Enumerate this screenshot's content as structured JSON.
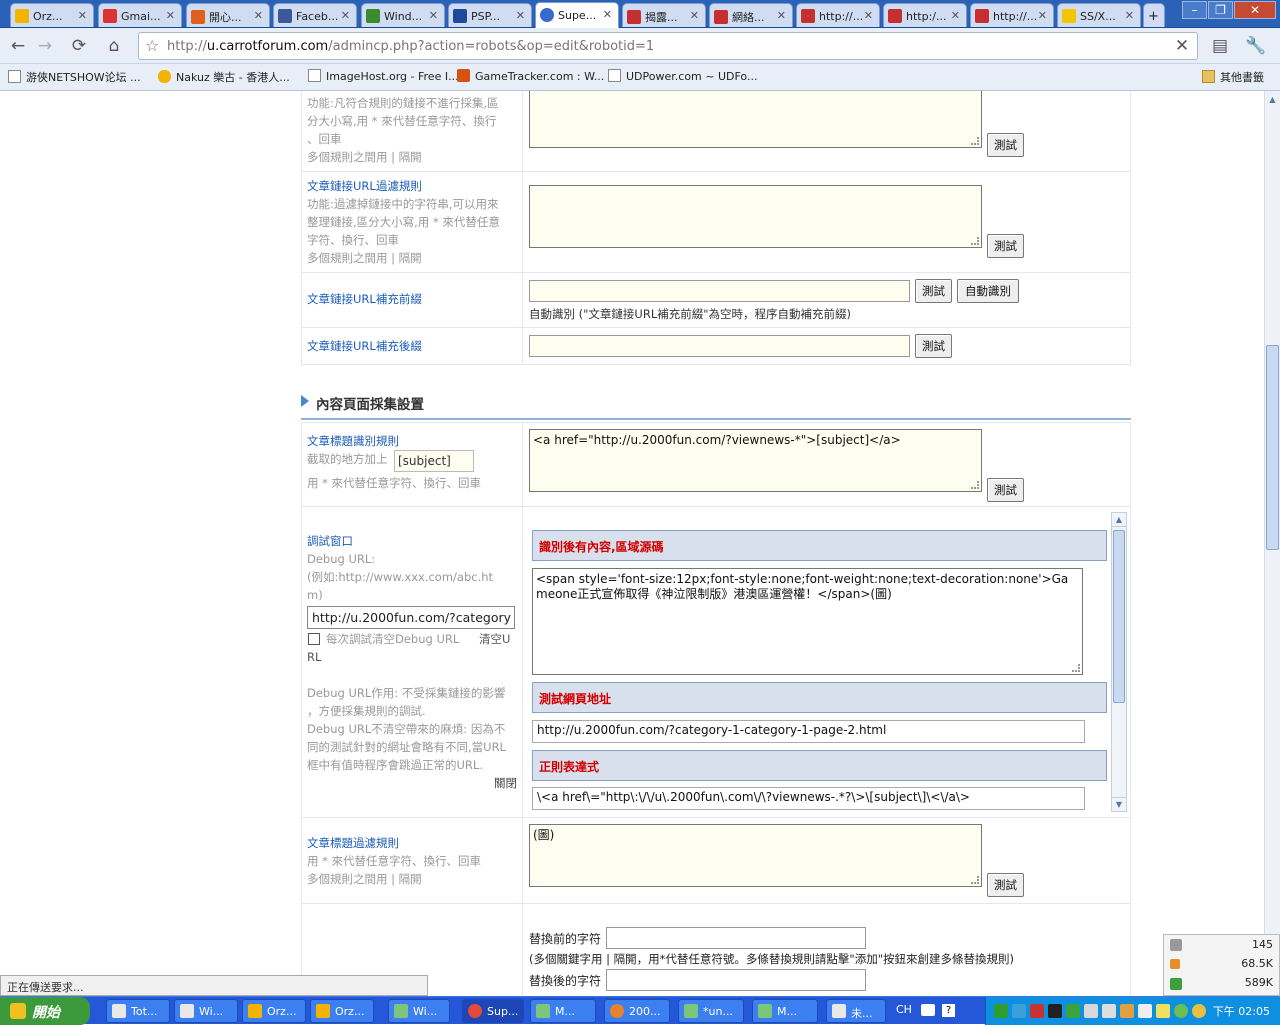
{
  "tabs": [
    {
      "label": "Orz...",
      "color": "#f2b400"
    },
    {
      "label": "Gmai...",
      "color": "#d33"
    },
    {
      "label": "開心...",
      "color": "#e05f1a"
    },
    {
      "label": "Faceb...",
      "color": "#3b5998"
    },
    {
      "label": "Wind...",
      "color": "#3b8a2f"
    },
    {
      "label": "PSP...",
      "color": "#1d4a9a"
    },
    {
      "label": "Supe...",
      "color": "#3a6ac7"
    },
    {
      "label": "揭露...",
      "color": "#c62f2f"
    },
    {
      "label": "網絡...",
      "color": "#c62f2f"
    },
    {
      "label": "http://...",
      "color": "#c62f2f"
    },
    {
      "label": "http:/...",
      "color": "#c62f2f"
    },
    {
      "label": "http://...",
      "color": "#c62f2f"
    },
    {
      "label": "SS/X...",
      "color": "#f3c400"
    }
  ],
  "address": {
    "prefix": "http://",
    "host": "u.carrotforum.com",
    "path": "/admincp.php?action=robots&op=edit&robotid=1"
  },
  "bookmarks": [
    {
      "label": "游俠NETSHOW论坛 ...",
      "icon": "page-icon"
    },
    {
      "label": "Nakuz 樂古 - 香港人...",
      "icon": "nakuz-icon"
    },
    {
      "label": "ImageHost.org - Free I...",
      "icon": "page-icon"
    },
    {
      "label": "GameTracker.com : W...",
      "icon": "gametracker-icon"
    },
    {
      "label": "UDPower.com ~ UDFo...",
      "icon": "page-icon"
    }
  ],
  "other_bookmarks": "其他書籤",
  "form": {
    "row1": {
      "lines": [
        "功能:凡符合規則的鏈接不進行採集,區",
        "分大小寫,用 * 來代替任意字符、換行",
        "、回車",
        "多個規則之間用 | 隔開"
      ]
    },
    "row2": {
      "title": "文章鏈接URL過濾規則",
      "lines": [
        "功能:過濾掉鏈接中的字符串,可以用來",
        "整理鏈接,區分大小寫,用 * 來代替任意",
        "字符、換行、回車",
        "多個規則之間用 | 隔開"
      ]
    },
    "row3": {
      "title": "文章鏈接URL補充前綴",
      "auto_btn": "自動識別",
      "note": "自動識別 (\"文章鏈接URL補充前綴\"為空時，程序自動補充前綴)"
    },
    "row4": {
      "title": "文章鏈接URL補充後綴"
    },
    "section_title": "內容頁面採集設置",
    "row5": {
      "title": "文章標題識別規則",
      "line1": "截取的地方加上",
      "tag": "[subject]",
      "line2": "用 * 來代替任意字符、換行、回車",
      "value": "<a href=\"http://u.2000fun.com/?viewnews-*\">[subject]</a>"
    },
    "debug": {
      "title": "調試窗口",
      "url_label": "Debug URL:",
      "example": [
        "(例如:http://www.xxx.com/abc.ht",
        "m)"
      ],
      "url_value": "http://u.2000fun.com/?category",
      "clear_checkbox": "每次調試清空Debug URL",
      "clear_link": [
        "清空U",
        "RL"
      ],
      "notes": [
        "Debug URL作用: 不受採集鏈接的影響",
        "，方便採集規則的調試.",
        "Debug URL不清空帶來的麻煩: 因為不",
        "同的測試針對的網址會略有不同,當URL",
        "框中有值時程序會跳過正常的URL."
      ],
      "close": "關閉",
      "result_header": "識別後有內容,區域源碼",
      "result_value": "<span style='font-size:12px;font-style:none;font-weight:none;text-decoration:none'>Gameone正式宣佈取得《神泣限制版》港澳區運營權！</span>(圖)",
      "page_header": "測試網頁地址",
      "page_value": "http://u.2000fun.com/?category-1-category-1-page-2.html",
      "regex_header": "正則表達式",
      "regex_value": "\\<a href\\=\"http\\:\\/\\/u\\.2000fun\\.com\\/\\?viewnews-.*?\\>\\[subject\\]\\<\\/a\\>"
    },
    "row6": {
      "title": "文章標題過濾規則",
      "line1": "用 * 來代替任意字符、換行、回車",
      "line2": "多個規則之間用 | 隔開",
      "value": "(圖)"
    },
    "row7": {
      "before_label": "替換前的字符",
      "note": "(多個關鍵字用 | 隔開，用*代替任意符號。多條替換規則請點擊\"添加\"按鈕來創建多條替換規則)",
      "after_label": "替換後的字符"
    },
    "test_btn": "測試"
  },
  "status": "正在傳送要求...",
  "netmon": {
    "count": "145",
    "up": "68.5K",
    "down": "589K"
  },
  "taskbar": {
    "start": "開始",
    "items": [
      "Tot...",
      "Wi...",
      "Orz...",
      "Orz...",
      "Wi...",
      "Sup...",
      "M...",
      "200...",
      "*un...",
      "M...",
      "未..."
    ],
    "lang": "CH",
    "clock": "下午 02:05"
  }
}
